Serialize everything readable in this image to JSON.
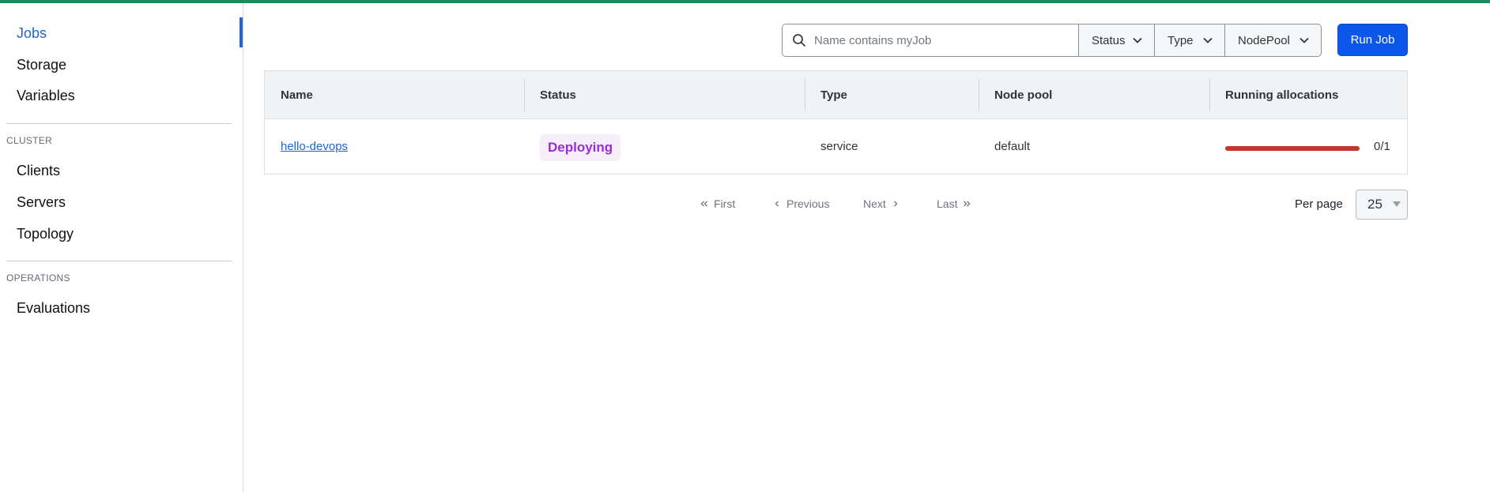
{
  "sidebar": {
    "items": [
      {
        "label": "Jobs",
        "active": true
      },
      {
        "label": "Storage"
      },
      {
        "label": "Variables"
      }
    ],
    "sections": [
      {
        "title": "CLUSTER",
        "items": [
          {
            "label": "Clients"
          },
          {
            "label": "Servers"
          },
          {
            "label": "Topology"
          }
        ]
      },
      {
        "title": "OPERATIONS",
        "items": [
          {
            "label": "Evaluations"
          }
        ]
      }
    ]
  },
  "toolbar": {
    "search_placeholder": "Name contains myJob",
    "search_value": "",
    "filters": {
      "status": "Status",
      "type": "Type",
      "nodepool": "NodePool"
    },
    "run_job_label": "Run Job"
  },
  "table": {
    "columns": [
      "Name",
      "Status",
      "Type",
      "Node pool",
      "Running allocations"
    ],
    "rows": [
      {
        "name": "hello-devops",
        "status": "Deploying",
        "type": "service",
        "node_pool": "default",
        "running_allocations": "0/1",
        "running": 0,
        "total": 1
      }
    ]
  },
  "pagination": {
    "first": "First",
    "previous": "Previous",
    "next": "Next",
    "last": "Last",
    "per_page_label": "Per page",
    "per_page_value": "25"
  },
  "colors": {
    "accent_top": "#1f8a5b",
    "primary": "#0c56e9",
    "link": "#2264d6",
    "deploying_badge_text": "#9a2dd0",
    "deploying_badge_bg": "#f7eefc",
    "allocation_bar": "#c0392b"
  },
  "icons": {
    "search": "search-icon",
    "chevron": "chevron-down-icon",
    "first": "double-chevron-left-icon",
    "previous": "chevron-left-icon",
    "next": "chevron-right-icon",
    "last": "double-chevron-right-icon"
  }
}
